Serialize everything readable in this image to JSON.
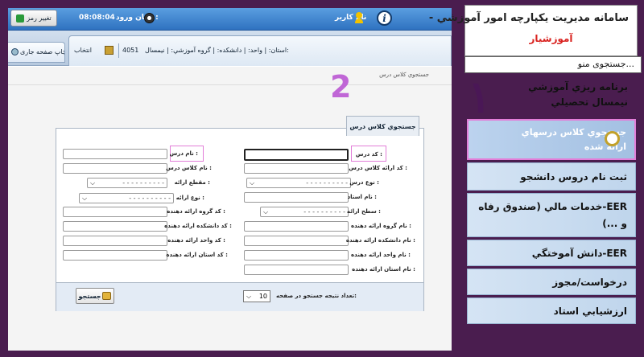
{
  "topbar": {
    "change_password": "تغيير رمز",
    "login_time_label": "زمان ورود :",
    "login_time": "08:08:04",
    "username_label": "نام کاربر"
  },
  "tabbar": {
    "print_page": "چاپ صفحه جاری",
    "select": "انتخاب",
    "term": "4051",
    "context": "استان: | واحد: | دانشکده: | گروه آموزشي: | نيمسال:"
  },
  "breadcrumb": "جستجوي کلاس درس",
  "annotation_2": "2",
  "panel": {
    "title": "جستجوي كلاس درس",
    "right": {
      "course_code": "کد درس :",
      "offered_class_code": "کد ارائه کلاس درس :",
      "course_type": "نوع درس :",
      "teacher_name": "نام استاد :",
      "offering_level": "سطح ارائه :",
      "group_name": "نام گروه ارائه دهنده :",
      "faculty_name": "نام دانشکده ارائه دهنده :",
      "unit_name": "نام واحد ارائه دهنده :",
      "province_name": "نام استان ارائه دهنده :"
    },
    "left": {
      "course_name": "نام درس :",
      "class_name": "نام کلاس درس :",
      "offering_section": "مقطع ارائه :",
      "offering_type": "نوع ارائه :",
      "group_code": "کد گروه ارائه دهنده :",
      "faculty_code": "کد دانشکده ارائه دهنده :",
      "unit_code": "کد واحد ارائه دهنده :",
      "province_code": "کد استان ارائه دهنده :"
    },
    "dropdown_placeholder": "- - - - - - - - - -",
    "page_size_label": "تعداد نتيجه جستجو در صفحه:",
    "page_size_value": "10",
    "search_button": "جستجو"
  },
  "sidebar": {
    "title": "سامانه مديريت يکپارچه امور آموزشي -",
    "subtitle": "آموزشيار",
    "search_placeholder": "جستجوی منو...",
    "annotation_1": "١",
    "items": [
      "برنامه ريزي آموزشي نيمسال تحصيلي",
      "جستجوي كلاس درسهاي ارائه شده",
      "ثبت نام دروس دانشجو",
      "EER-خدمات مالي (صندوق رفاه و ...)",
      "EER-دانش آموختگي",
      "درخواست/مجوز",
      "ارزشيابي استاد"
    ]
  }
}
